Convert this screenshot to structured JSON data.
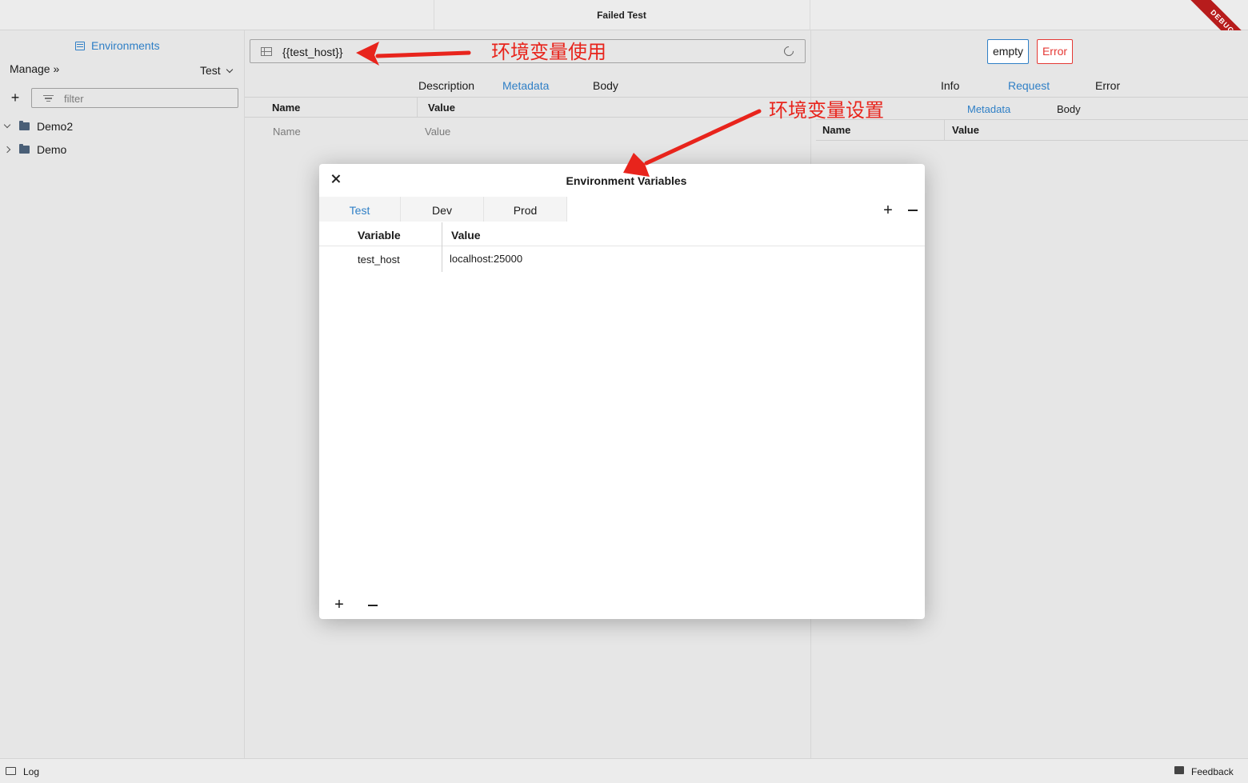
{
  "window": {
    "title": "Failed Test",
    "badge": "DEBUG"
  },
  "sidebar": {
    "environments_label": "Environments",
    "manage_label": "Manage »",
    "environment_selected": "Test",
    "filter_placeholder": "filter",
    "add_icon": "plus-icon",
    "tree": [
      {
        "label": "Demo2",
        "expanded": true
      },
      {
        "label": "Demo",
        "expanded": false
      }
    ]
  },
  "center": {
    "url_value": "{{test_host}}",
    "annotation_usage": "环境变量使用",
    "tabs": [
      "Description",
      "Metadata",
      "Body"
    ],
    "active_tab": "Metadata",
    "columns": [
      "Name",
      "Value"
    ],
    "placeholders": {
      "name": "Name",
      "value": "Value"
    }
  },
  "right": {
    "status_buttons": [
      "empty",
      "Error"
    ],
    "tabs": [
      "Info",
      "Request",
      "Error"
    ],
    "active_tab": "Request",
    "subtabs": [
      "Metadata",
      "Body"
    ],
    "active_subtab": "Metadata",
    "columns": [
      "Name",
      "Value"
    ],
    "annotation_settings": "环境变量设置"
  },
  "dialog": {
    "title": "Environment Variables",
    "tabs": [
      "Test",
      "Dev",
      "Prod"
    ],
    "active_tab": "Test",
    "columns": [
      "Variable",
      "Value"
    ],
    "rows": [
      {
        "variable": "test_host",
        "value": "localhost:25000"
      }
    ]
  },
  "footer": {
    "log_label": "Log",
    "feedback_label": "Feedback"
  },
  "colors": {
    "accent": "#2f7fc6",
    "error": "#e53935",
    "annotation": "#e8241c"
  }
}
